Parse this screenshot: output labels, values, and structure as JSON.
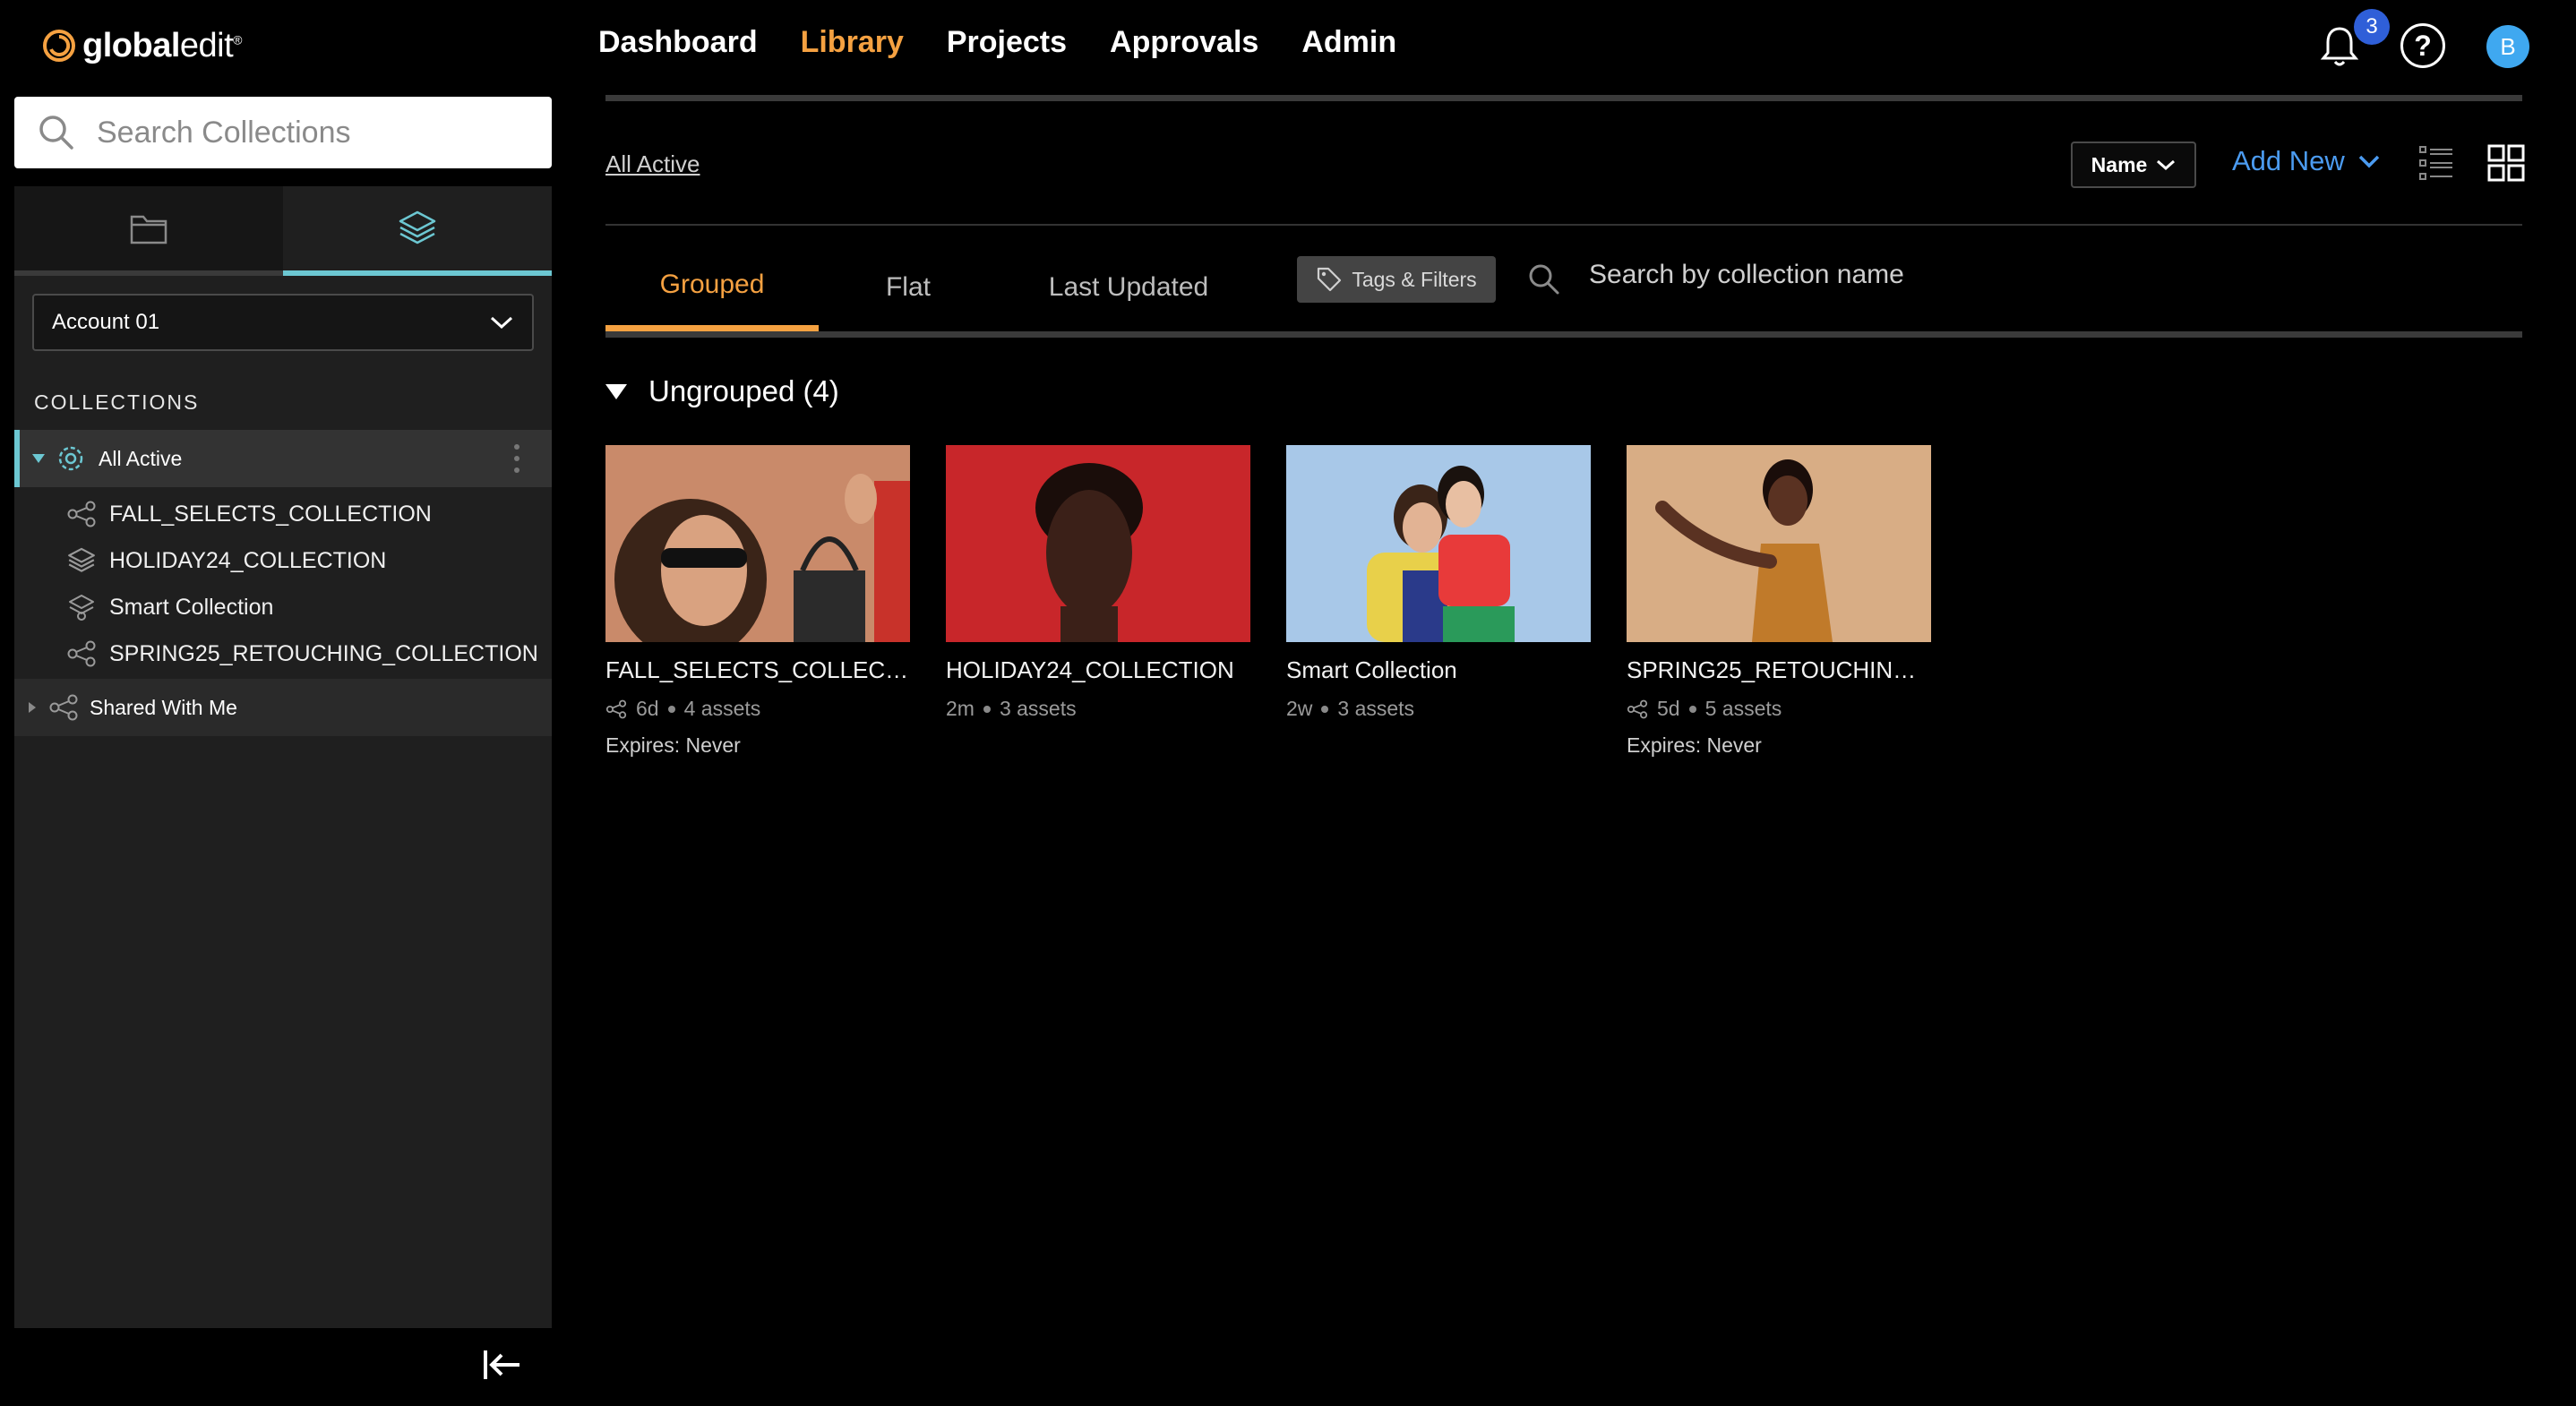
{
  "app": {
    "logo_text_bold": "global",
    "logo_text_light": "edit",
    "logo_tm": "®"
  },
  "nav": {
    "items": [
      "Dashboard",
      "Library",
      "Projects",
      "Approvals",
      "Admin"
    ],
    "active": "Library",
    "notification_count": "3",
    "help_label": "?",
    "avatar_initial": "B"
  },
  "sidebar": {
    "search_placeholder": "Search Collections",
    "account_select": "Account 01",
    "collections_heading": "COLLECTIONS",
    "all_active_label": "All Active",
    "items": [
      {
        "label": "FALL_SELECTS_COLLECTION",
        "icon": "share-icon"
      },
      {
        "label": "HOLIDAY24_COLLECTION",
        "icon": "layers-icon"
      },
      {
        "label": "Smart Collection",
        "icon": "smart-collection-icon"
      },
      {
        "label": "SPRING25_RETOUCHING_COLLECTION",
        "icon": "share-icon"
      }
    ],
    "shared_label": "Shared With Me"
  },
  "toolbar": {
    "breadcrumb": "All Active",
    "sort_label": "Name",
    "add_new_label": "Add New"
  },
  "tabs": {
    "items": [
      "Grouped",
      "Flat",
      "Last Updated"
    ],
    "active": "Grouped",
    "tags_filters_label": "Tags & Filters",
    "search_placeholder": "Search by collection name"
  },
  "group": {
    "label": "Ungrouped (4)"
  },
  "cards": [
    {
      "title": "FALL_SELECTS_COLLECTION",
      "age": "6d",
      "assets": "4 assets",
      "expires": "Expires: Never",
      "shared": true
    },
    {
      "title": "HOLIDAY24_COLLECTION",
      "age": "2m",
      "assets": "3 assets",
      "expires": "",
      "shared": false
    },
    {
      "title": "Smart Collection",
      "age": "2w",
      "assets": "3 assets",
      "expires": "",
      "shared": false
    },
    {
      "title": "SPRING25_RETOUCHING_C...",
      "age": "5d",
      "assets": "5 assets",
      "expires": "Expires: Never",
      "shared": true
    }
  ],
  "colors": {
    "accent_orange": "#f5a141",
    "accent_teal": "#6cc7d2",
    "link_blue": "#4b9bf0",
    "badge_blue": "#2f5fd8"
  }
}
